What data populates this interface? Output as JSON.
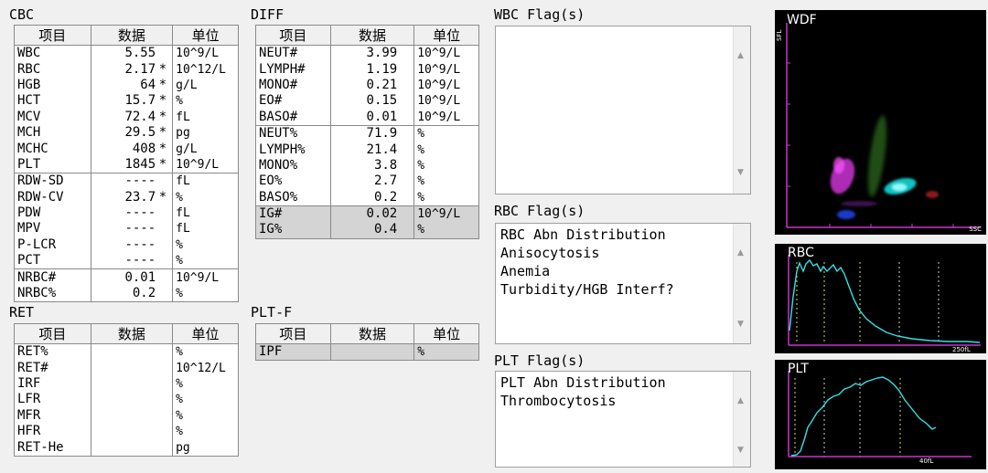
{
  "cbc": {
    "title": "CBC",
    "headers": [
      "项目",
      "数据",
      "单位"
    ],
    "rows": [
      {
        "name": "WBC",
        "value": "5.55",
        "flag": "",
        "unit": "10^9/L"
      },
      {
        "name": "RBC",
        "value": "2.17",
        "flag": "*",
        "unit": "10^12/L"
      },
      {
        "name": "HGB",
        "value": "64",
        "flag": "*",
        "unit": "g/L"
      },
      {
        "name": "HCT",
        "value": "15.7",
        "flag": "*",
        "unit": "%"
      },
      {
        "name": "MCV",
        "value": "72.4",
        "flag": "*",
        "unit": "fL"
      },
      {
        "name": "MCH",
        "value": "29.5",
        "flag": "*",
        "unit": "pg"
      },
      {
        "name": "MCHC",
        "value": "408",
        "flag": "*",
        "unit": "g/L"
      },
      {
        "name": "PLT",
        "value": "1845",
        "flag": "*",
        "unit": "10^9/L"
      },
      {
        "name": "RDW-SD",
        "value": "----",
        "flag": "",
        "unit": "fL"
      },
      {
        "name": "RDW-CV",
        "value": "23.7",
        "flag": "*",
        "unit": "%"
      },
      {
        "name": "PDW",
        "value": "----",
        "flag": "",
        "unit": "fL"
      },
      {
        "name": "MPV",
        "value": "----",
        "flag": "",
        "unit": "fL"
      },
      {
        "name": "P-LCR",
        "value": "----",
        "flag": "",
        "unit": "%"
      },
      {
        "name": "PCT",
        "value": "----",
        "flag": "",
        "unit": "%"
      },
      {
        "name": "NRBC#",
        "value": "0.01",
        "flag": "",
        "unit": "10^9/L"
      },
      {
        "name": "NRBC%",
        "value": "0.2",
        "flag": "",
        "unit": "%"
      }
    ]
  },
  "diff": {
    "title": "DIFF",
    "headers": [
      "项目",
      "数据",
      "单位"
    ],
    "rows": [
      {
        "name": "NEUT#",
        "value": "3.99",
        "unit": "10^9/L"
      },
      {
        "name": "LYMPH#",
        "value": "1.19",
        "unit": "10^9/L"
      },
      {
        "name": "MONO#",
        "value": "0.21",
        "unit": "10^9/L"
      },
      {
        "name": "EO#",
        "value": "0.15",
        "unit": "10^9/L"
      },
      {
        "name": "BASO#",
        "value": "0.01",
        "unit": "10^9/L"
      },
      {
        "name": "NEUT%",
        "value": "71.9",
        "unit": "%"
      },
      {
        "name": "LYMPH%",
        "value": "21.4",
        "unit": "%"
      },
      {
        "name": "MONO%",
        "value": "3.8",
        "unit": "%"
      },
      {
        "name": "EO%",
        "value": "2.7",
        "unit": "%"
      },
      {
        "name": "BASO%",
        "value": "0.2",
        "unit": "%"
      },
      {
        "name": "IG#",
        "value": "0.02",
        "unit": "10^9/L"
      },
      {
        "name": "IG%",
        "value": "0.4",
        "unit": "%"
      }
    ]
  },
  "ret": {
    "title": "RET",
    "headers": [
      "项目",
      "数据",
      "单位"
    ],
    "rows": [
      {
        "name": "RET%",
        "value": "",
        "unit": "%"
      },
      {
        "name": "RET#",
        "value": "",
        "unit": "10^12/L"
      },
      {
        "name": "IRF",
        "value": "",
        "unit": "%"
      },
      {
        "name": "LFR",
        "value": "",
        "unit": "%"
      },
      {
        "name": "MFR",
        "value": "",
        "unit": "%"
      },
      {
        "name": "HFR",
        "value": "",
        "unit": "%"
      },
      {
        "name": "RET-He",
        "value": "",
        "unit": "pg"
      }
    ]
  },
  "pltf": {
    "title": "PLT-F",
    "headers": [
      "项目",
      "数据",
      "单位"
    ],
    "rows": [
      {
        "name": "IPF",
        "value": "",
        "unit": "%"
      }
    ]
  },
  "flags": {
    "wbc": {
      "title": "WBC Flag(s)",
      "lines": []
    },
    "rbc": {
      "title": "RBC Flag(s)",
      "lines": [
        "RBC Abn Distribution",
        "Anisocytosis",
        "Anemia",
        "Turbidity/HGB Interf?"
      ]
    },
    "plt": {
      "title": "PLT Flag(s)",
      "lines": [
        "PLT Abn Distribution",
        "Thrombocytosis"
      ]
    }
  },
  "plots": {
    "wdf": {
      "title": "WDF",
      "y_axis": "SFL",
      "x_axis": "SSC"
    },
    "rbc": {
      "title": "RBC",
      "x_max_label": "250fL"
    },
    "plt": {
      "title": "PLT",
      "x_max_label": "40fL"
    }
  },
  "colors": {
    "curve": "#33e0e8",
    "axis": "#cc33cc",
    "guide": "#c8e63c"
  }
}
